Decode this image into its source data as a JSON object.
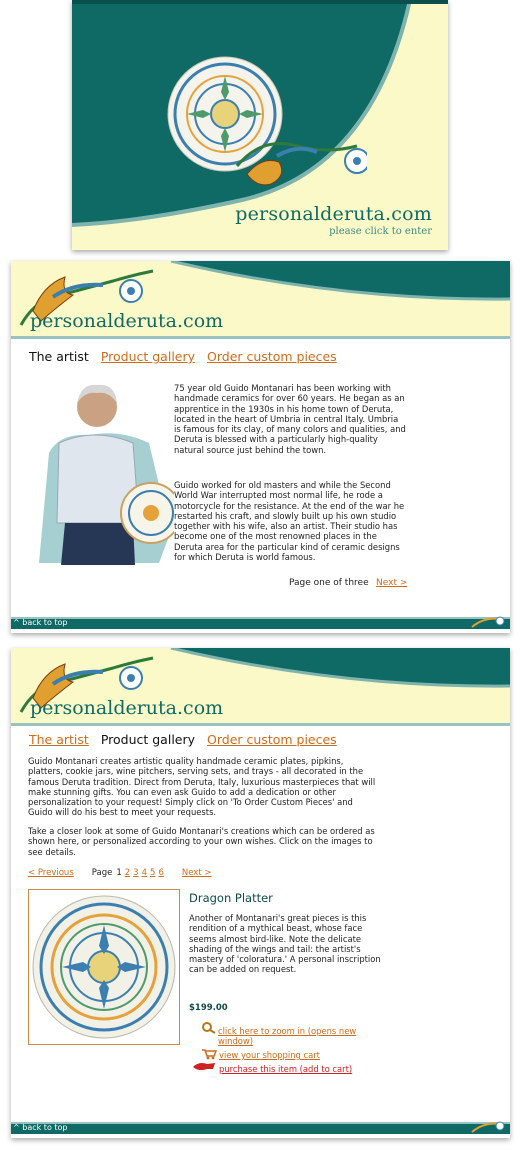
{
  "site": {
    "brand": "personalderuta.com",
    "enter": "please click to enter"
  },
  "colors": {
    "teal": "#0f6a65",
    "cream": "#fbf9c7",
    "link": "#cf6b1a",
    "buy": "#cc2222"
  },
  "nav": {
    "artist": "The artist",
    "gallery": "Product gallery",
    "order": "Order custom pieces"
  },
  "artist_page": {
    "paragraph1": "75 year old Guido Montanari has been working with handmade ceramics for over 60 years. He began as an apprentice in the 1930s in his home town of Deruta, located in the heart of Umbria in central Italy. Umbria is famous for its clay, of many colors and qualities, and Deruta is blessed with a particularly high-quality natural source just behind the town.",
    "paragraph2": "Guido worked for old masters and while the Second World War interrupted most normal life, he rode a motorcycle for the resistance. At the end of the war he restarted his craft, and slowly built up his own studio together with his wife, also an artist. Their studio has become one of the most renowned places in the Deruta area for the particular kind of ceramic designs for which Deruta is world famous.",
    "pager": "Page one of three",
    "next": "Next >"
  },
  "gallery_page": {
    "intro1": "Guido Montanari creates artistic quality handmade ceramic plates, pipkins, platters, cookie jars, wine pitchers, serving sets, and trays - all decorated in the famous Deruta tradition. Direct from Deruta, Italy, luxurious masterpieces that will make stunning gifts. You can even ask Guido to add a dedication or other personalization to your request! Simply click on 'To Order Custom Pieces' and Guido will do his best to meet your requests.",
    "intro2": "Take a closer look at some of Guido Montanari's creations which can be ordered as shown here, or personalized according to your own wishes. Click on the images to see details.",
    "prev": "< Previous",
    "page_label": "Page",
    "current_page": "1",
    "pages": [
      "2",
      "3",
      "4",
      "5",
      "6"
    ],
    "next": "Next >",
    "item": {
      "title": "Dragon Platter",
      "description": "Another of Montanari's great pieces is this rendition of a mythical beast, whose face seems almost bird-like. Note the delicate shading of the wings and tail: the artist's mastery of 'coloratura.' A personal inscription can be added on request.",
      "price": "$199.00",
      "zoom": "click here to zoom in (opens new window)",
      "cart": "view your shopping cart",
      "buy": "purchase this item (add to cart)"
    }
  },
  "footer": {
    "back_to_top": "^ back to top"
  }
}
